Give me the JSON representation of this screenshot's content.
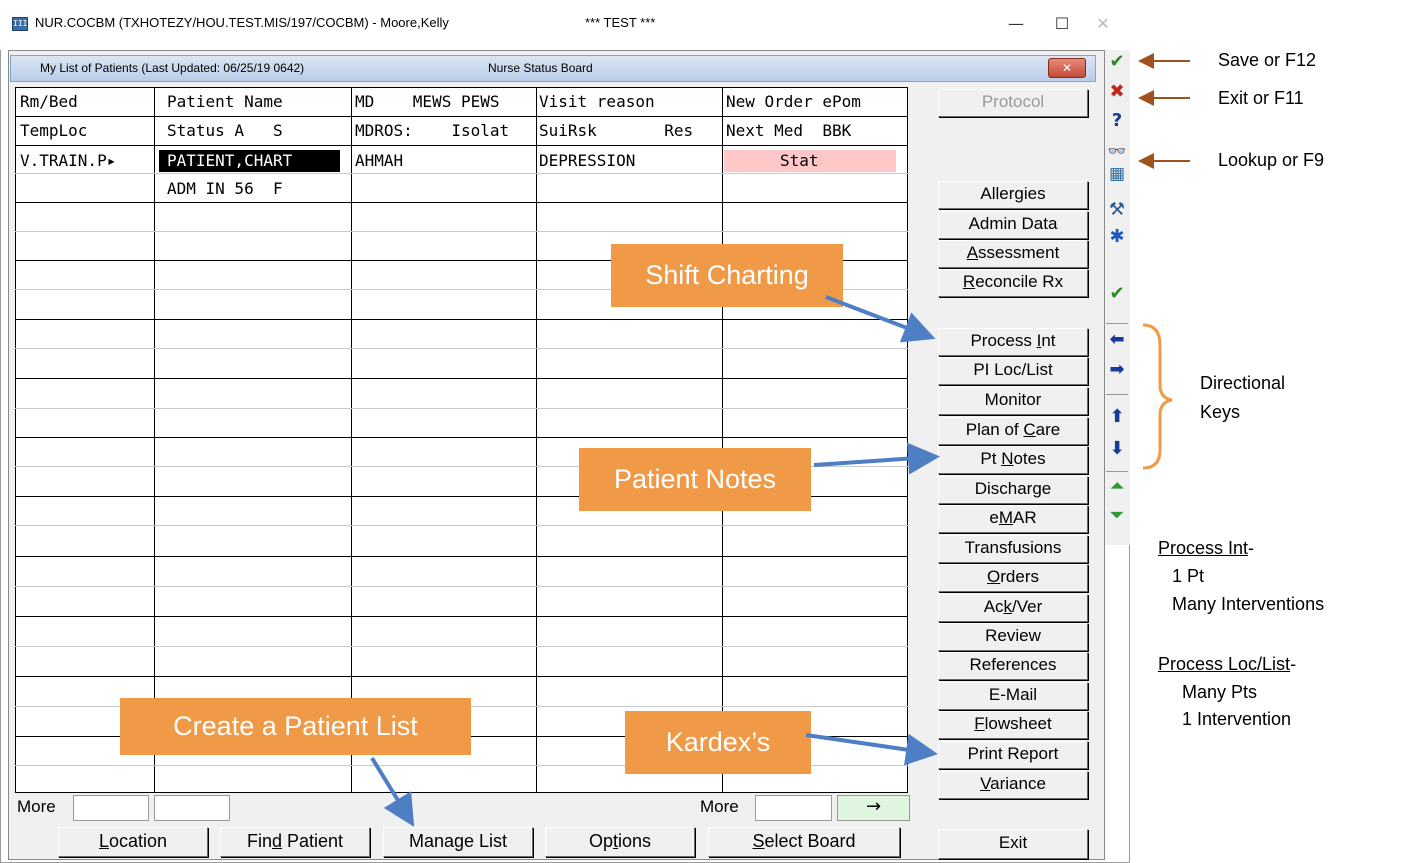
{
  "window": {
    "title": "NUR.COCBM (TXHOTEZY/HOU.TEST.MIS/197/COCBM) - Moore,Kelly",
    "test_label": "*** TEST ***",
    "minimize": "—",
    "maximize": "☐",
    "close": "✕"
  },
  "form": {
    "list_title": "My List of Patients (Last Updated: 06/25/19  0642)",
    "board_title": "Nurse Status Board",
    "close": "✕"
  },
  "table": {
    "header_row1": [
      "Rm/Bed",
      "Patient Name",
      "MD    MEWS PEWS",
      "Visit reason",
      "New Order ePom"
    ],
    "header_row2": [
      "TempLoc",
      "Status A   S",
      "MDROS:    Isolat",
      "SuiRsk       Res",
      "Next Med  BBK"
    ],
    "rows": [
      {
        "room": "V.TRAIN.P▸",
        "name": "PATIENT,CHART",
        "md": "AHMAH",
        "visit": "DEPRESSION",
        "order": "Stat",
        "status": "ADM IN 56  F"
      }
    ]
  },
  "side_buttons": {
    "protocol": "Protocol",
    "allergies": "Allergies",
    "admin_data": "Admin Data",
    "assessment": "Assessment",
    "reconcile_rx": "Reconcile Rx",
    "process_int": "Process Int",
    "pi_loc_list": "PI Loc/List",
    "monitor": "Monitor",
    "plan_of_care": "Plan of Care",
    "pt_notes": "Pt Notes",
    "discharge": "Discharge",
    "emar": "eMAR",
    "transfusions": "Transfusions",
    "orders": "Orders",
    "ack_ver": "Ack/Ver",
    "review": "Review",
    "references": "References",
    "email": "E-Mail",
    "flowsheet": "Flowsheet",
    "print_report": "Print Report",
    "variance": "Variance",
    "exit": "Exit"
  },
  "bottom": {
    "more_left": "More",
    "more_right": "More",
    "arrow": "→",
    "location": "Location",
    "find_patient": "Find Patient",
    "manage_list": "Manage List",
    "options": "Options",
    "select_board": "Select Board"
  },
  "toolbar_icons": [
    "check-icon",
    "x-icon",
    "help-icon",
    "binoculars-icon",
    "calendar-icon",
    "tools-icon",
    "asterisk-icon",
    "check-all-icon",
    "arrow-left-icon",
    "arrow-right-icon",
    "arrow-up-icon",
    "arrow-down-icon",
    "page-up-icon",
    "page-down-icon"
  ],
  "toolbar_glyphs": {
    "save": "✔",
    "exit": "✖",
    "help": "?",
    "lookup": "👓",
    "calendar": "▦",
    "tools": "⚒",
    "asterisk": "✱",
    "check_all": "✔",
    "left": "⬅",
    "right": "➡",
    "up": "⬆",
    "down": "⬇",
    "page_up": "⏶",
    "page_down": "⏷"
  },
  "annotations": {
    "save": "Save or F12",
    "exit": "Exit or F11",
    "lookup": "Lookup or F9",
    "directional_1": "Directional",
    "directional_2": "Keys",
    "process_int_title": "Process Int",
    "process_int_suffix": "-",
    "process_int_l1": "1 Pt",
    "process_int_l2": "Many Interventions",
    "process_loc_title": "Process Loc/List",
    "process_loc_suffix": "-",
    "process_loc_l1": "Many Pts",
    "process_loc_l2": "1 Intervention",
    "shift_charting": "Shift Charting",
    "patient_notes": "Patient Notes",
    "create_list": "Create a Patient List",
    "kardex": "Kardex’s"
  },
  "colors": {
    "callout": "#f09a48",
    "arrow_blue": "#4e7fc4",
    "arrow_brown": "#a0521e",
    "stat_bg": "#ffc8c8",
    "bracket": "#f09a48"
  }
}
